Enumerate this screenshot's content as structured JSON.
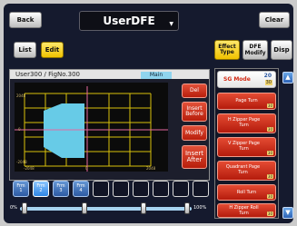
{
  "header": {
    "back_label": "Back",
    "title": "UserDFE",
    "clear_label": "Clear"
  },
  "tabs": {
    "list_label": "List",
    "edit_label": "Edit",
    "effect_type_label": "Effect Type",
    "dfe_modify_label": "DFE Modify",
    "disp_label": "Disp"
  },
  "editor": {
    "title": "User300 / FigNo.300",
    "main_tag": "Main",
    "axis": {
      "top_left": "2048",
      "mid_left": "0",
      "bottom_left": "-2048",
      "bottom_center": "0",
      "bottom_right": "2048"
    }
  },
  "edit_buttons": {
    "del": "Del",
    "insert_before": "Insert Before",
    "modify": "Modify",
    "insert_after": "Insert After"
  },
  "frames": [
    {
      "label": "Frm",
      "num": "1"
    },
    {
      "label": "Frm",
      "num": "2"
    },
    {
      "label": "Frm",
      "num": "3"
    },
    {
      "label": "Frm",
      "num": "4"
    }
  ],
  "selected_frame": "2",
  "slider": {
    "min_label": "0%",
    "max_label": "100%"
  },
  "effect_list": {
    "sg_mode": {
      "label": "SG Mode",
      "value_top": "20",
      "value_bottom": "30"
    },
    "items": [
      {
        "label": "Page Turn",
        "num": "30"
      },
      {
        "label": "H Zipper Page Turn",
        "num": "30"
      },
      {
        "label": "V Zipper Page Turn",
        "num": "30"
      },
      {
        "label": "Quadrant Page Turn",
        "num": "30"
      },
      {
        "label": "Roll Turn",
        "num": "30"
      },
      {
        "label": "H Zipper Roll Turn",
        "num": "30"
      }
    ]
  },
  "colors": {
    "panel_bg": "#151a2e",
    "accent_red": "#d23a22",
    "accent_yellow": "#f5cf1a",
    "shape_fill": "#67cbe7",
    "grid_yellow": "#d8c20b",
    "crosshair_pink": "#e468a2"
  },
  "icons": {
    "title_dropdown": "chevron-down-icon",
    "scroll_up": "arrow-up-icon",
    "scroll_down": "arrow-down-icon"
  }
}
